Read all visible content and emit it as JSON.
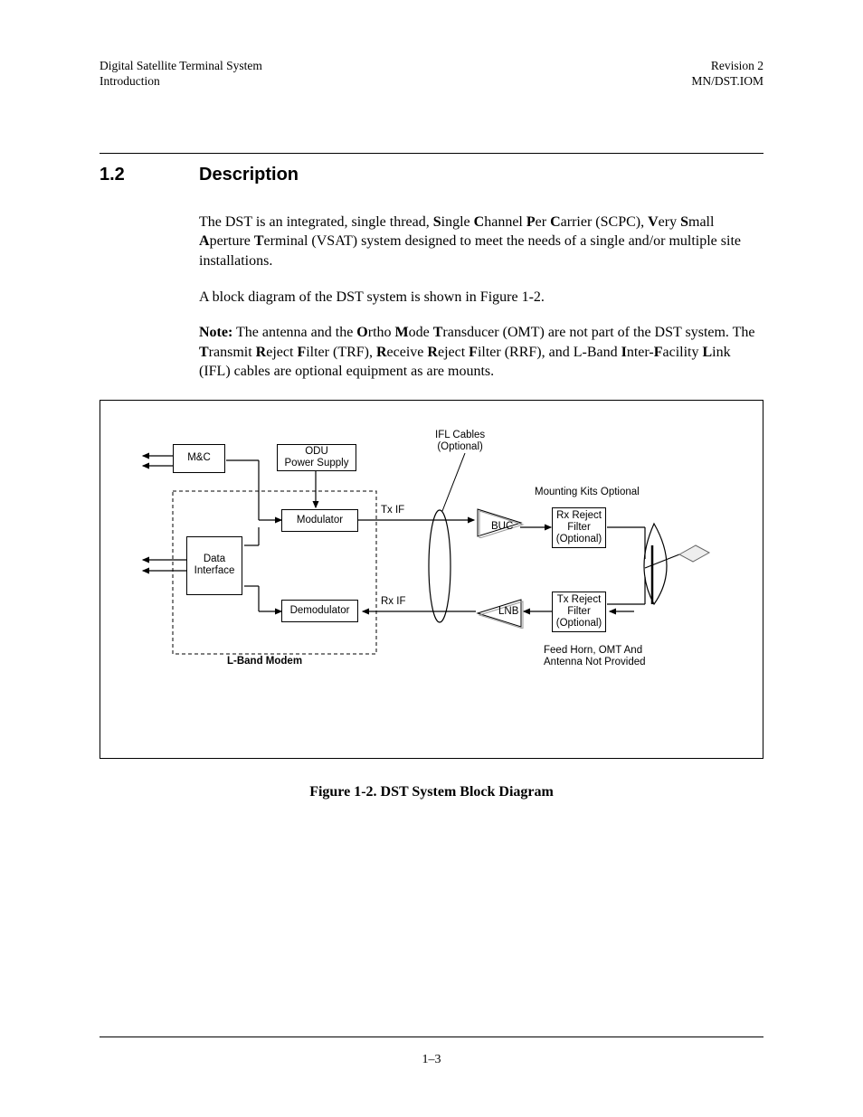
{
  "header": {
    "left1": "Digital Satellite Terminal System",
    "left2": "Introduction",
    "right1": "Revision 2",
    "right2": "MN/DST.IOM"
  },
  "section": {
    "num": "1.2",
    "title": "Description"
  },
  "para1_pre": "The DST is an integrated, single thread, ",
  "para1_b1": "S",
  "para1_t1": "ingle ",
  "para1_b2": "C",
  "para1_t2": "hannel ",
  "para1_b3": "P",
  "para1_t3": "er ",
  "para1_b4": "C",
  "para1_t4": "arrier (SCPC), ",
  "para1_b5": "V",
  "para1_t5": "ery ",
  "para1_b6": "S",
  "para1_t6": "mall ",
  "para1_b7": "A",
  "para1_t7": "perture ",
  "para1_b8": "T",
  "para1_t8": "erminal (VSAT) system designed to meet the needs of a single and/or multiple site installations.",
  "para2": "A block diagram of the DST system is shown in Figure 1-2.",
  "note_label": "Note:",
  "note_t0": " The antenna and the ",
  "note_b1": "O",
  "note_t1": "rtho ",
  "note_b2": "M",
  "note_t2": "ode ",
  "note_b3": "T",
  "note_t3": "ransducer (OMT) are not part of the DST system. The ",
  "note_b4": "T",
  "note_t4": "ransmit ",
  "note_b5": "R",
  "note_t5": "eject ",
  "note_b6": "F",
  "note_t6": "ilter (TRF), ",
  "note_b7": "R",
  "note_t7": "eceive ",
  "note_b8": "R",
  "note_t8": "eject ",
  "note_b9": "F",
  "note_t9": "ilter (RRF), and L-Band ",
  "note_b10": "I",
  "note_t10": "nter-",
  "note_b11": "F",
  "note_t11": "acility ",
  "note_b12": "L",
  "note_t12": "ink (IFL) cables are optional equipment as are mounts.",
  "diagram": {
    "mc": "M&C",
    "odu": "ODU\nPower Supply",
    "modulator": "Modulator",
    "demodulator": "Demodulator",
    "data_iface": "Data\nInterface",
    "buc": "BUC",
    "lnb": "LNB",
    "rx_reject": "Rx Reject\nFilter\n(Optional)",
    "tx_reject": "Tx Reject\nFilter\n(Optional)",
    "ifl": "IFL Cables\n(Optional)",
    "mount": "Mounting Kits Optional",
    "txif": "Tx  IF",
    "rxif": "Rx  IF",
    "lband": "L-Band Modem",
    "feedhorn": "Feed Horn, OMT And\nAntenna Not Provided"
  },
  "figure_caption": "Figure 1-2.  DST System Block Diagram",
  "page_number": "1–3"
}
